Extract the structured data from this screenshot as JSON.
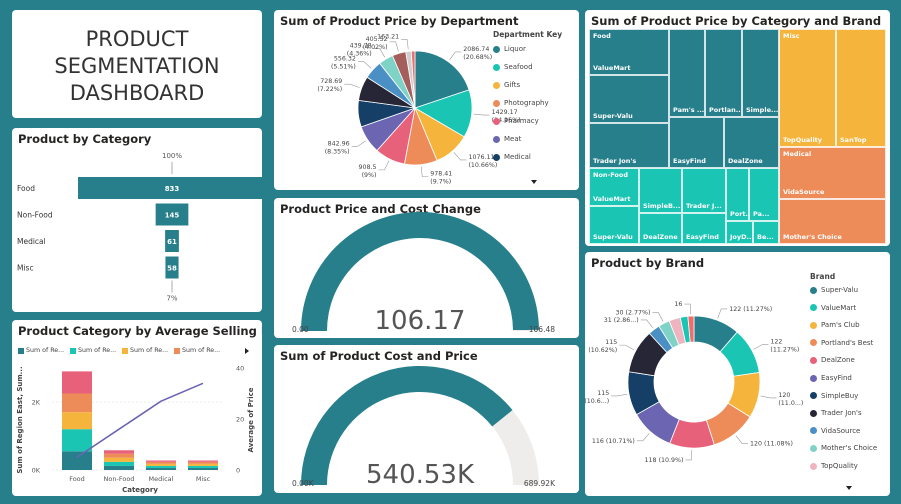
{
  "title_card": {
    "title_lines": [
      "PRODUCT",
      "SEGMENTATION",
      "DASHBOARD"
    ]
  },
  "colors": {
    "teal": "#277f8c",
    "aqua": "#1ac5b3",
    "orange": "#f5b53c",
    "salmon": "#ee8c59",
    "pink": "#e8617a",
    "purple": "#6b65b2",
    "navy": "#163f67",
    "dark": "#262636",
    "lightgray": "#eeedeb",
    "tm_food": "#277f8c",
    "tm_nonfood": "#1ac5b3",
    "tm_misc": "#f5b53c",
    "tm_medical": "#ee8c59"
  },
  "category_funnel": {
    "title": "Product by Category",
    "top_label": "100%",
    "bottom_label": "7%",
    "rows": [
      {
        "category": "Food",
        "value": 833,
        "label": "833"
      },
      {
        "category": "Non-Food",
        "value": 145,
        "label": "145"
      },
      {
        "category": "Medical",
        "value": 61,
        "label": "61"
      },
      {
        "category": "Misc",
        "value": 58,
        "label": "58"
      }
    ]
  },
  "dept_pie": {
    "title": "Sum of Product Price by Department",
    "legend_title": "Department Key",
    "legend": [
      "Liquor",
      "Seafood",
      "Gifts",
      "Photography",
      "Pharmacy",
      "Meat",
      "Medical"
    ]
  },
  "treemap": {
    "title": "Sum of Product Price by Category and Brand",
    "group_labels": [
      "Food",
      "Non-Food",
      "Misc",
      "Medical"
    ],
    "cell_labels": [
      "ValueMart",
      "Super-Valu",
      "Trader Jon's",
      "Pam's ...",
      "Portlan...",
      "Simple...",
      "EasyFind",
      "DealZone",
      "ValueMart",
      "Super-Valu",
      "SimpleB...",
      "DealZone",
      "Trader J...",
      "EasyFind",
      "Port...",
      "Pa...",
      "JoyD...",
      "Be...",
      "TopQuality",
      "SanTop",
      "VidaSource",
      "Mother's Choice"
    ]
  },
  "gauge1": {
    "title": "Product Price and Cost Change",
    "value": "106.17",
    "min": "0.00",
    "max": "106.48",
    "fraction": 0.997
  },
  "gauge2": {
    "title": "Sum of Product Cost and Price",
    "value": "540.53K",
    "min": "0.00K",
    "max": "689.92K",
    "fraction": 0.7835
  },
  "avg_price": {
    "title": "Product Category by Average Selling Price",
    "legend_items": [
      "Sum of Re...",
      "Sum of Re...",
      "Sum of Re...",
      "Sum of Re..."
    ],
    "y_left_label": "Sum of Region East, Sum...",
    "y_right_label": "Average of Price",
    "x_label": "Category",
    "left_ticks": [
      "2K",
      "0K"
    ],
    "right_ticks": [
      "40",
      "20",
      "0"
    ]
  },
  "brand_donut": {
    "title": "Product by Brand",
    "legend_title": "Brand",
    "legend": [
      "Super-Valu",
      "ValueMart",
      "Pam's Club",
      "Portland's Best",
      "DealZone",
      "EasyFind",
      "SimpleBuy",
      "Trader Jon's",
      "VidaSource",
      "Mother's Choice",
      "TopQuality"
    ]
  },
  "chart_data": [
    {
      "type": "bar",
      "title": "Product by Category",
      "categories": [
        "Food",
        "Non-Food",
        "Medical",
        "Misc"
      ],
      "values": [
        833,
        145,
        61,
        58
      ]
    },
    {
      "type": "pie",
      "title": "Sum of Product Price by Department",
      "slices": [
        {
          "label": "2086.74 (20.68%)",
          "value": 2086.74,
          "color": "#277f8c"
        },
        {
          "label": "1429.17 (14.16%)",
          "value": 1429.17,
          "color": "#1ac5b3"
        },
        {
          "label": "1076.11 (10.66%)",
          "value": 1076.11,
          "color": "#f5b53c"
        },
        {
          "label": "978.41 (9.7%)",
          "value": 978.41,
          "color": "#ee8c59"
        },
        {
          "label": "908.5 (9%)",
          "value": 908.5,
          "color": "#e8617a"
        },
        {
          "label": "842.96 (8.35%)",
          "value": 842.96,
          "color": "#6b65b2"
        },
        {
          "label": "",
          "value": 790.0,
          "color": "#163f67"
        },
        {
          "label": "728.69 (7.22%)",
          "value": 728.69,
          "color": "#262636"
        },
        {
          "label": "556.32 (5.51%)",
          "value": 556.32,
          "color": "#4a90c4"
        },
        {
          "label": "439.78 (4.36%)",
          "value": 439.78,
          "color": "#7fd3c6"
        },
        {
          "label": "405.52 (4.02%)",
          "value": 405.52,
          "color": "#a45e5b"
        },
        {
          "label": "163.21",
          "value": 163.21,
          "color": "#cfcfcf"
        },
        {
          "label": "",
          "value": 110.0,
          "color": "#ee6d6d"
        }
      ]
    },
    {
      "type": "bar",
      "title": "Product Category by Average Selling Price",
      "categories": [
        "Food",
        "Non-Food",
        "Medical",
        "Misc"
      ],
      "stack_values": [
        [
          550,
          650,
          500,
          550,
          650
        ],
        [
          120,
          120,
          120,
          120,
          100
        ],
        [
          60,
          60,
          60,
          60,
          40
        ],
        [
          60,
          60,
          60,
          60,
          40
        ]
      ],
      "stack_colors": [
        "#277f8c",
        "#1ac5b3",
        "#f5b53c",
        "#ee8c59",
        "#e8617a"
      ],
      "line_values": [
        5,
        16,
        27,
        34
      ],
      "y_left_lim": [
        0,
        3000
      ],
      "y_right_lim": [
        0,
        40
      ]
    },
    {
      "type": "pie",
      "title": "Product by Brand",
      "donut": true,
      "slices": [
        {
          "label": "122 (11.27%)",
          "value": 122,
          "color": "#277f8c"
        },
        {
          "label": "122 (11.27%)",
          "value": 122,
          "color": "#1ac5b3"
        },
        {
          "label": "120 (11.0...)",
          "value": 120,
          "color": "#f5b53c"
        },
        {
          "label": "120 (11.08%)",
          "value": 120,
          "color": "#ee8c59"
        },
        {
          "label": "118 (10.9%)",
          "value": 118,
          "color": "#e8617a"
        },
        {
          "label": "116 (10.71%)",
          "value": 116,
          "color": "#6b65b2"
        },
        {
          "label": "115 (10.6...)",
          "value": 115,
          "color": "#163f67"
        },
        {
          "label": "115 (10.62%)",
          "value": 115,
          "color": "#262636"
        },
        {
          "label": "31 (2.86...)",
          "value": 31,
          "color": "#4a90c4"
        },
        {
          "label": "30 (2.77%)",
          "value": 30,
          "color": "#7fd3c6"
        },
        {
          "label": "",
          "value": 30,
          "color": "#eeb4bf"
        },
        {
          "label": "",
          "value": 20,
          "color": "#1ac5b3"
        },
        {
          "label": "16",
          "value": 16,
          "color": "#ee6d6d"
        }
      ]
    }
  ]
}
